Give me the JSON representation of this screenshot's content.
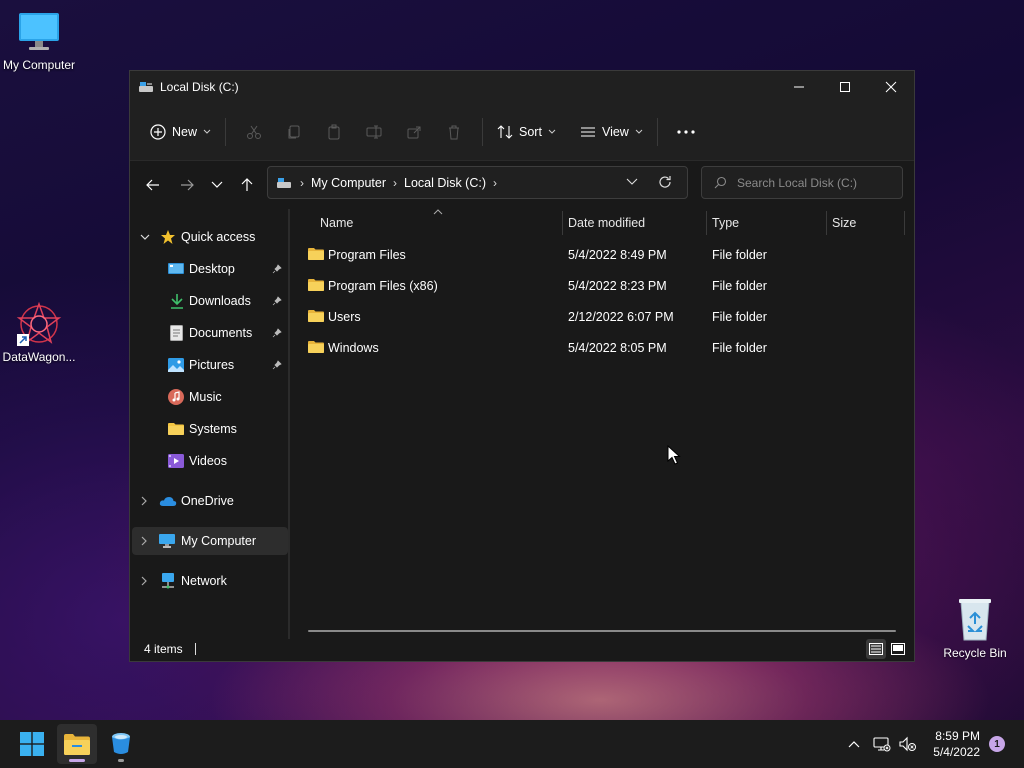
{
  "desktop": {
    "icons": [
      {
        "label": "My Computer",
        "icon": "monitor-icon"
      },
      {
        "label": "DataWagon...",
        "icon": "datawagon-shortcut-icon"
      },
      {
        "label": "Recycle Bin",
        "icon": "recycle-bin-icon"
      }
    ]
  },
  "window": {
    "title": "Local Disk (C:)",
    "controls": {
      "minimize": "minimize-icon",
      "maximize": "maximize-icon",
      "close": "close-icon"
    }
  },
  "toolbar": {
    "new_label": "New",
    "sort_label": "Sort",
    "view_label": "View",
    "more_label": "...",
    "disabled_actions": [
      "cut",
      "copy",
      "paste",
      "rename",
      "share",
      "delete"
    ]
  },
  "address": {
    "crumbs": [
      "My Computer",
      "Local Disk (C:)"
    ]
  },
  "search": {
    "placeholder": "Search Local Disk (C:)"
  },
  "sidebar": {
    "quick_access": "Quick access",
    "items": [
      {
        "label": "Desktop",
        "icon": "desktop-icon",
        "pinned": true
      },
      {
        "label": "Downloads",
        "icon": "download-icon",
        "pinned": true
      },
      {
        "label": "Documents",
        "icon": "document-icon",
        "pinned": true
      },
      {
        "label": "Pictures",
        "icon": "pictures-icon",
        "pinned": true
      },
      {
        "label": "Music",
        "icon": "music-icon",
        "pinned": false
      },
      {
        "label": "Systems",
        "icon": "folder-icon",
        "pinned": false
      },
      {
        "label": "Videos",
        "icon": "videos-icon",
        "pinned": false
      }
    ],
    "onedrive": "OneDrive",
    "my_computer": "My Computer",
    "network": "Network"
  },
  "columns": {
    "name": "Name",
    "date": "Date modified",
    "type": "Type",
    "size": "Size"
  },
  "files": [
    {
      "name": "Program Files",
      "date": "5/4/2022 8:49 PM",
      "type": "File folder"
    },
    {
      "name": "Program Files (x86)",
      "date": "5/4/2022 8:23 PM",
      "type": "File folder"
    },
    {
      "name": "Users",
      "date": "2/12/2022 6:07 PM",
      "type": "File folder"
    },
    {
      "name": "Windows",
      "date": "5/4/2022 8:05 PM",
      "type": "File folder"
    }
  ],
  "status": {
    "count": "4 items"
  },
  "taskbar": {
    "time": "8:59 PM",
    "date": "5/4/2022",
    "notifications": "1"
  },
  "colors": {
    "accent": "#0078d4",
    "folder": "#f4c642",
    "window_bg": "#191919"
  }
}
